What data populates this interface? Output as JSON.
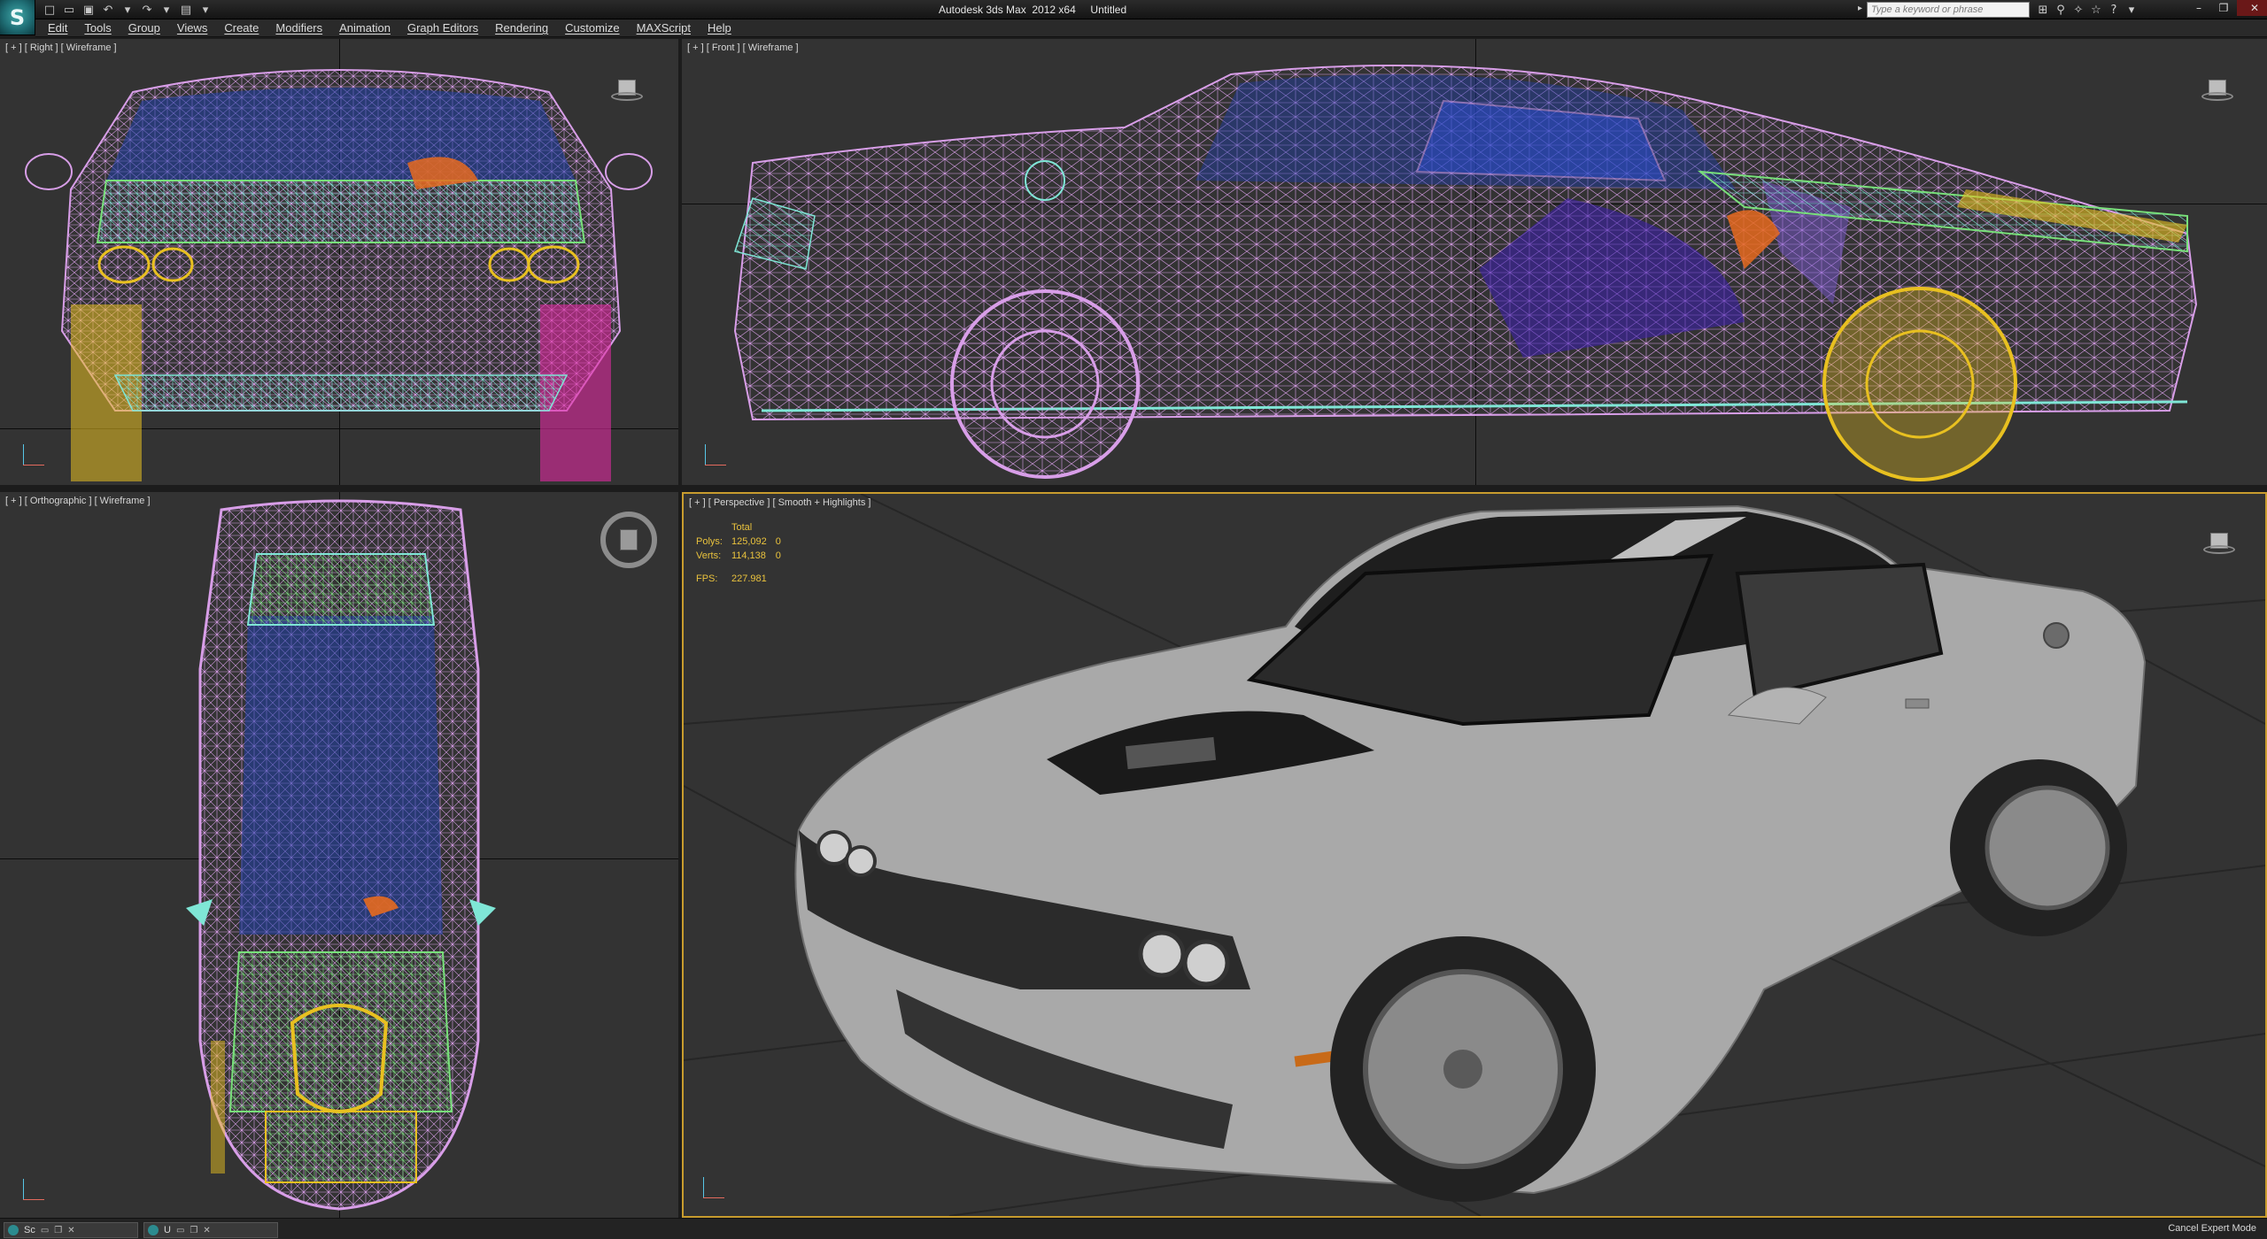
{
  "window": {
    "title": "Autodesk 3ds Max  2012 x64     Untitled"
  },
  "app_logo": {
    "glyph": "S"
  },
  "quick_access": {
    "icons": [
      "new-file-icon",
      "open-file-icon",
      "save-icon",
      "undo-icon",
      "undo-dropdown-icon",
      "redo-icon",
      "redo-dropdown-icon",
      "project-folder-icon",
      "qat-dropdown-icon"
    ],
    "glyphs": [
      "□",
      "▭",
      "▣",
      "↶",
      "▾",
      "↷",
      "▾",
      "▤",
      "▾"
    ]
  },
  "search": {
    "placeholder": "Type a keyword or phrase",
    "arrow": "▸"
  },
  "infocenter": {
    "icons": [
      "binoculars-icon",
      "subscription-icon",
      "communication-icon",
      "favorites-icon",
      "help-icon",
      "help-dropdown-icon"
    ],
    "glyphs": [
      "⊞",
      "⚲",
      "✧",
      "☆",
      "?",
      "▾"
    ]
  },
  "window_controls": {
    "minimize": "–",
    "restore": "❐",
    "close": "✕"
  },
  "menu": {
    "items": [
      "Edit",
      "Tools",
      "Group",
      "Views",
      "Create",
      "Modifiers",
      "Animation",
      "Graph Editors",
      "Rendering",
      "Customize",
      "MAXScript",
      "Help"
    ]
  },
  "viewports": {
    "right": {
      "label": "[ + ] [ Right ] [ Wireframe ]"
    },
    "front": {
      "label": "[ + ] [ Front ] [ Wireframe ]"
    },
    "ortho": {
      "label": "[ + ] [ Orthographic ] [ Wireframe ]"
    },
    "perspective": {
      "label": "[ + ] [ Perspective ] [ Smooth + Highlights ]",
      "stats": {
        "header": "Total",
        "polys_label": "Polys:",
        "polys_value": "125,092",
        "polys_sel": "0",
        "verts_label": "Verts:",
        "verts_value": "114,138",
        "verts_sel": "0",
        "fps_label": "FPS:",
        "fps_value": "227.981"
      }
    }
  },
  "statusbar": {
    "tasks": [
      {
        "label": "Sc",
        "ctrl1": "▭",
        "ctrl2": "❐",
        "ctrl3": "✕"
      },
      {
        "label": "U",
        "ctrl1": "▭",
        "ctrl2": "❐",
        "ctrl3": "✕"
      }
    ],
    "cancel_expert": "Cancel Expert Mode"
  },
  "colors": {
    "active_border": "#c89c2e",
    "viewport_bg": "#333333",
    "stats_text": "#e9c23d",
    "wire_pink": "#d89ee8",
    "wire_cyan": "#7fe6d6",
    "wire_blue": "#2a4fd6",
    "wire_green": "#78e07a",
    "wire_yellow": "#e8c020",
    "wire_magenta": "#e02aa0",
    "wire_orange": "#e66a1e",
    "car_body": "#a9a9a9"
  }
}
